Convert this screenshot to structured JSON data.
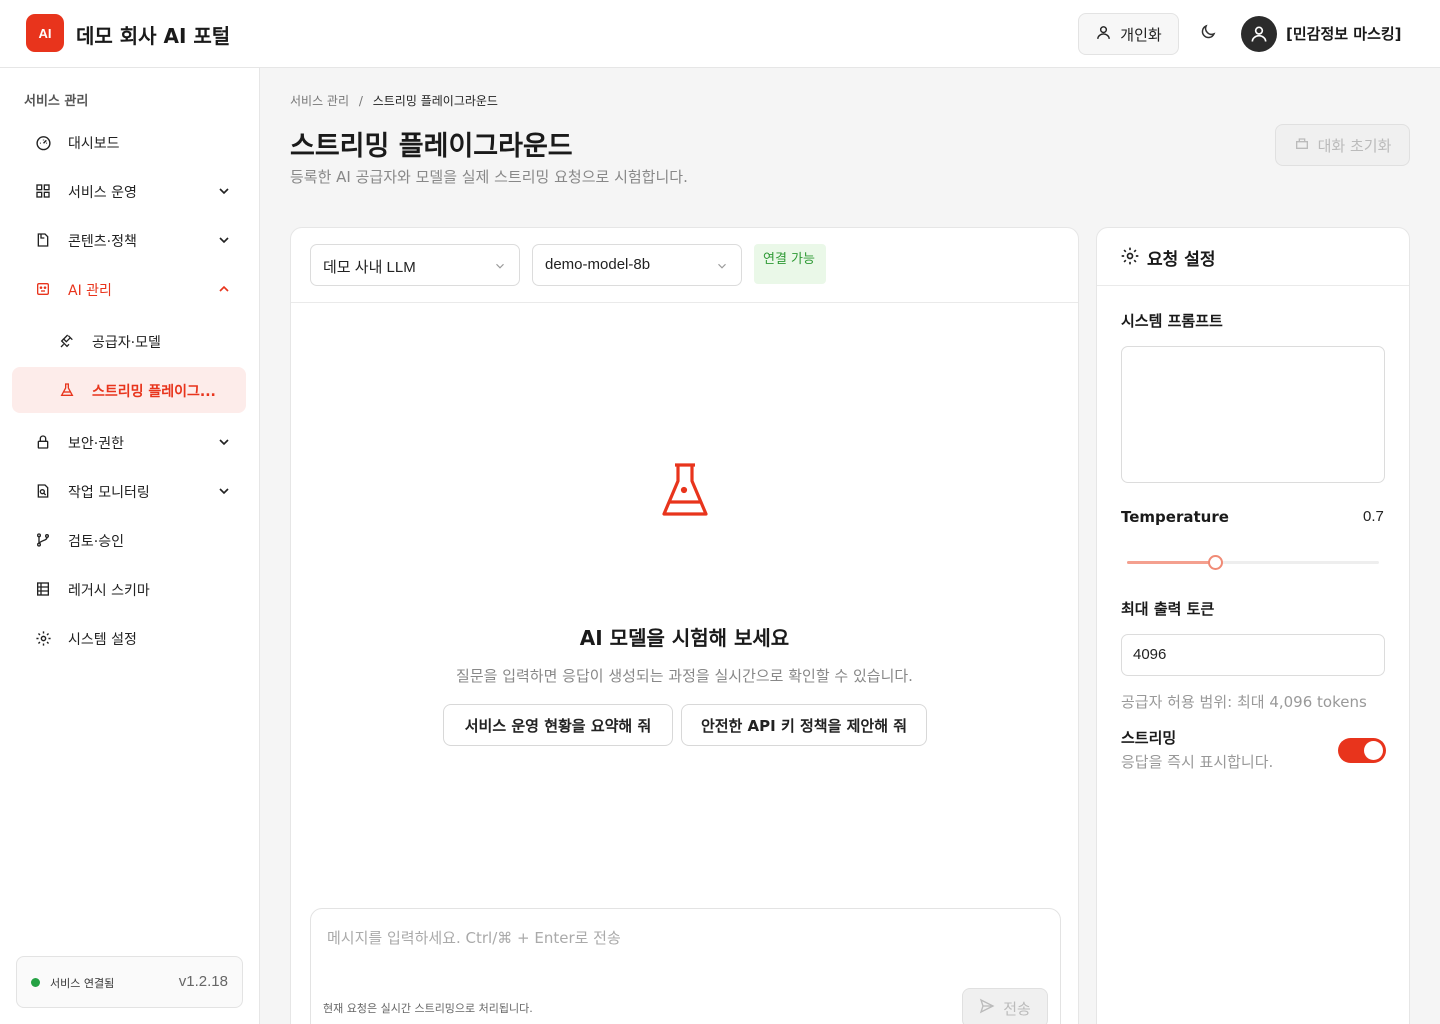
{
  "header": {
    "logo_text": "AI",
    "app_title": "데모 회사 AI 포털",
    "personalize_label": "개인화",
    "user_name": "[민감정보 마스킹]",
    "accent_color": "#e8341c"
  },
  "sidebar": {
    "section_title": "서비스 관리",
    "items": [
      {
        "label": "대시보드",
        "icon": "dashboard-icon"
      },
      {
        "label": "서비스 운영",
        "icon": "grid-icon"
      },
      {
        "label": "콘텐츠·정책",
        "icon": "document-icon"
      },
      {
        "label": "AI 관리",
        "icon": "robot-icon"
      },
      {
        "label": "보안·권한",
        "icon": "lock-icon"
      },
      {
        "label": "작업 모니터링",
        "icon": "monitor-icon"
      },
      {
        "label": "검토·승인",
        "icon": "branch-icon"
      },
      {
        "label": "레거시 스키마",
        "icon": "table-icon"
      },
      {
        "label": "시스템 설정",
        "icon": "gear-icon"
      }
    ],
    "sub_items": [
      {
        "label": "공급자·모델",
        "icon": "plug-icon"
      },
      {
        "label": "스트리밍 플레이그...",
        "icon": "flask-icon"
      }
    ],
    "status_text": "서비스 연결됨",
    "version": "v1.2.18"
  },
  "breadcrumb": {
    "parent": "서비스 관리",
    "separator": "/",
    "current": "스트리밍 플레이그라운드"
  },
  "page": {
    "title": "스트리밍 플레이그라운드",
    "description": "등록한 AI 공급자와 모델을 실제 스트리밍 요청으로 시험합니다.",
    "reset_label": "대화 초기화"
  },
  "chat": {
    "provider_value": "데모 사내 LLM",
    "model_value": "demo-model-8b",
    "connection_badge": "연결 가능",
    "empty_title": "AI 모델을 시험해 보세요",
    "empty_desc": "질문을 입력하면 응답이 생성되는 과정을 실시간으로 확인할 수 있습니다.",
    "suggestions": [
      "서비스 운영 현황을 요약해 줘",
      "안전한 API 키 정책을 제안해 줘"
    ],
    "input_placeholder": "메시지를 입력하세요. Ctrl/⌘ + Enter로 전송",
    "composer_note": "현재 요청은 실시간 스트리밍으로 처리됩니다.",
    "send_label": "전송"
  },
  "settings": {
    "title": "요청 설정",
    "system_prompt_label": "시스템 프롬프트",
    "system_prompt_value": "",
    "temperature_label": "Temperature",
    "temperature_value": "0.7",
    "temperature_fraction": 0.35,
    "max_tokens_label": "최대 출력 토큰",
    "max_tokens_value": "4096",
    "max_tokens_hint": "공급자 허용 범위: 최대 4,096 tokens",
    "streaming_label": "스트리밍",
    "streaming_desc": "응답을 즉시 표시합니다.",
    "streaming_on": true
  }
}
